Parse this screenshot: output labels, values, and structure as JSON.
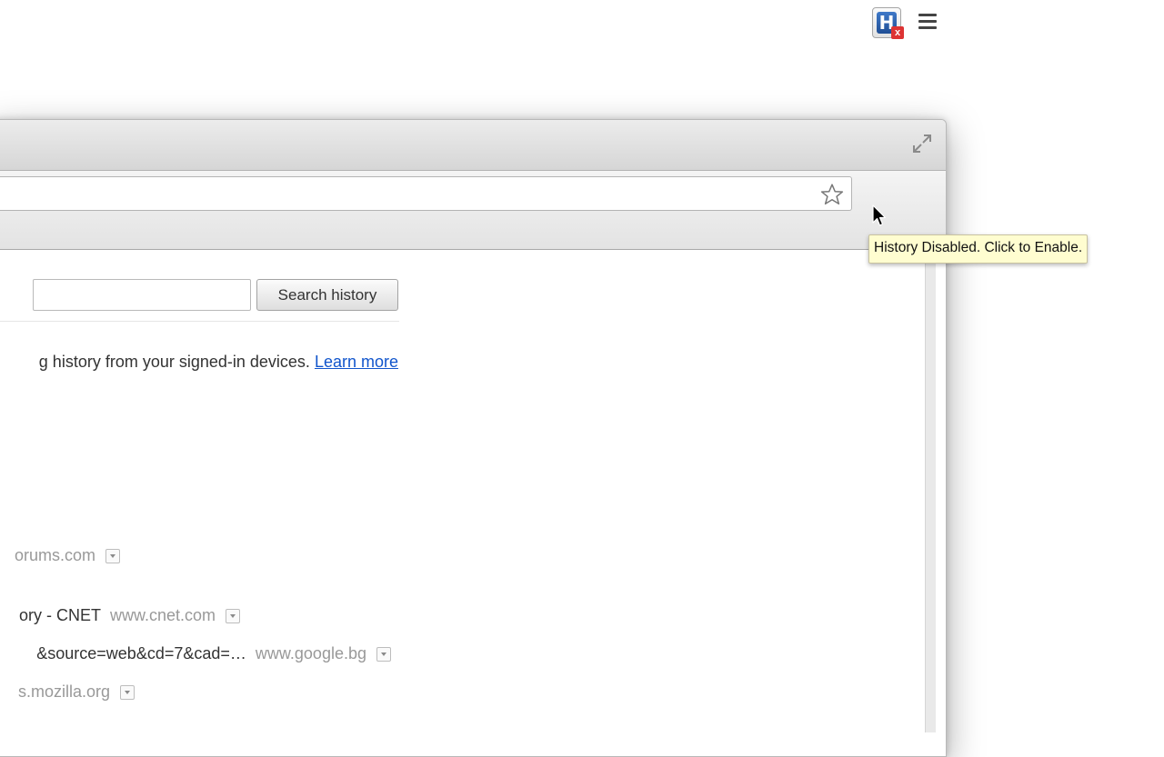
{
  "toolbar": {
    "bookmark_icon": "star-icon",
    "extension_icon": "history-disabled-extension-icon",
    "extension_letter": "H",
    "extension_badge": "x",
    "menu_icon": "hamburger-menu-icon"
  },
  "tooltip": {
    "text": "History Disabled. Click to Enable."
  },
  "history_page": {
    "search_input_value": "",
    "search_button_label": "Search history",
    "info_text": "g history from your signed-in devices.",
    "learn_more_label": "Learn more",
    "entries": [
      {
        "title": "",
        "domain": "orums.com"
      },
      {
        "title": "ory - CNET",
        "domain": "www.cnet.com"
      },
      {
        "title": "&source=web&cd=7&cad=…",
        "domain": "www.google.bg"
      },
      {
        "title": "",
        "domain": "s.mozilla.org"
      }
    ]
  }
}
